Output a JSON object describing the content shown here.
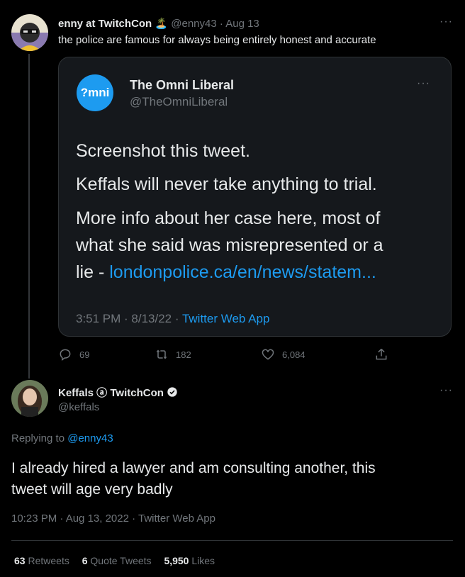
{
  "tweet": {
    "display_name": "enny at TwitchCon",
    "handle": "@enny43",
    "date": "Aug 13",
    "separator": "·",
    "text": "the police are famous for always being entirely honest and accurate",
    "more": "···"
  },
  "quoted": {
    "display_name": "The Omni Liberal",
    "handle": "@TheOmniLiberal",
    "logo_text": "?mni",
    "more": "···",
    "line1": "Screenshot this tweet.",
    "line2": "Keffals will never take anything to trial.",
    "line3a": "More info about her case here, most of",
    "line3b": "what she said was misrepresented or a",
    "line3c_prefix": "lie - ",
    "line3c_link": "londonpolice.ca/en/news/statem...",
    "timestamp": "3:51 PM · 8/13/22 ·",
    "source": "Twitter Web App"
  },
  "actions": {
    "replies": "69",
    "retweets": "182",
    "likes": "6,084"
  },
  "reply": {
    "display_name": "Keffals ⓐ TwitchCon",
    "handle": "@keffals",
    "more": "···",
    "replying_prefix": "Replying to",
    "replying_to": "@enny43",
    "text_line1": "I already hired a lawyer and am consulting another, this",
    "text_line2": "tweet will age very badly",
    "timestamp": "10:23 PM · Aug 13, 2022 · Twitter Web App"
  },
  "stats": {
    "retweets_count": "63",
    "retweets_label": "Retweets",
    "quotes_count": "6",
    "quotes_label": "Quote Tweets",
    "likes_count": "5,950",
    "likes_label": "Likes"
  },
  "colors": {
    "accent": "#1d9bf0",
    "muted": "#71767b",
    "background": "#000000"
  }
}
